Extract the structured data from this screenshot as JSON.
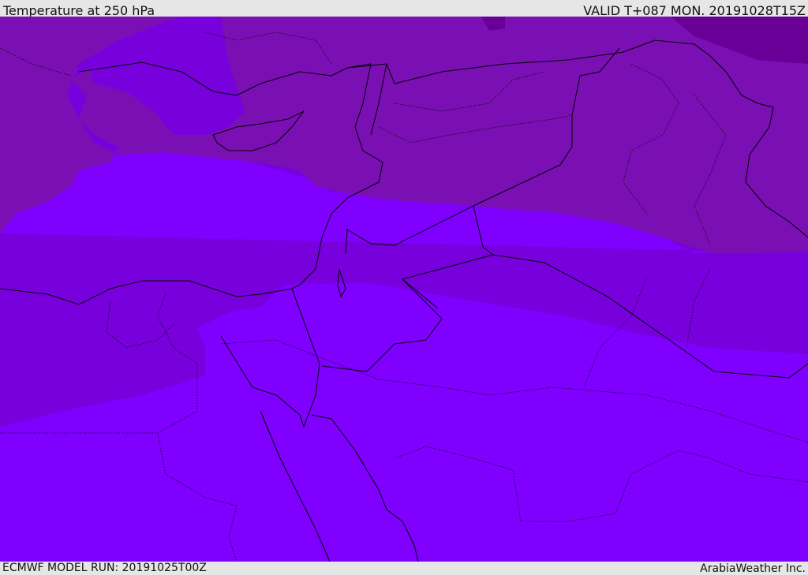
{
  "header": {
    "title": "Temperature at 250 hPa",
    "valid": "VALID T+087 MON. 20191028T15Z"
  },
  "footer": {
    "model_run": "ECMWF MODEL RUN: 20191025T00Z",
    "credit": "ArabiaWeather Inc."
  },
  "colors": {
    "coldest": "#680098",
    "cold": "#7a10b4",
    "mid": "#7700dc",
    "warm": "#7f00ff"
  }
}
